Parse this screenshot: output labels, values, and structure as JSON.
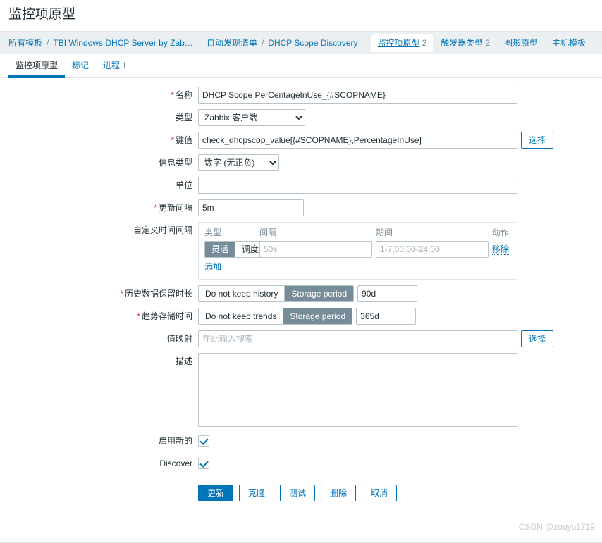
{
  "page": {
    "title": "监控项原型",
    "watermark": "CSDN @zouyu1719"
  },
  "breadcrumb": {
    "items": [
      {
        "label": "所有模板",
        "type": "link"
      },
      {
        "label": "TBI Windows DHCP Server by Zab…",
        "type": "link"
      },
      {
        "label": "自动发现清单",
        "type": "link"
      },
      {
        "label": "DHCP Scope Discovery",
        "type": "link"
      }
    ],
    "separator": "/",
    "tabs": [
      {
        "label": "监控项原型",
        "count": "2",
        "active": true
      },
      {
        "label": "触发器类型",
        "count": "2",
        "active": false
      },
      {
        "label": "图形原型",
        "count": "",
        "active": false
      },
      {
        "label": "主机模板",
        "count": "",
        "active": false
      }
    ]
  },
  "subtabs": [
    {
      "label": "监控项原型",
      "count": "",
      "active": true
    },
    {
      "label": "标记",
      "count": "",
      "active": false
    },
    {
      "label": "进程",
      "count": "1",
      "active": false
    }
  ],
  "form": {
    "name": {
      "label": "名称",
      "required": true,
      "value": "DHCP Scope PerCentageInUse_{#SCOPNAME}"
    },
    "type": {
      "label": "类型",
      "required": false,
      "value": "Zabbix 客户端",
      "options": [
        "Zabbix 客户端"
      ]
    },
    "key": {
      "label": "键值",
      "required": true,
      "value": "check_dhcpscop_value[{#SCOPNAME},PercentageInUse]",
      "select_button": "选择"
    },
    "info_type": {
      "label": "信息类型",
      "required": false,
      "value": "数字 (无正负)",
      "options": [
        "数字 (无正负)"
      ]
    },
    "units": {
      "label": "单位",
      "required": false,
      "value": ""
    },
    "update_interval": {
      "label": "更新间隔",
      "required": true,
      "value": "5m"
    },
    "custom_intervals": {
      "label": "自定义时间间隔",
      "required": false,
      "headers": {
        "type": "类型",
        "interval": "间隔",
        "period": "期间",
        "action": "动作"
      },
      "rows": [
        {
          "type_options": [
            "灵活",
            "调度"
          ],
          "type_selected": "灵活",
          "interval_value": "",
          "interval_placeholder": "50s",
          "period_value": "",
          "period_placeholder": "1-7,00:00-24:00",
          "remove_label": "移除"
        }
      ],
      "add_label": "添加"
    },
    "history": {
      "label": "历史数据保留时长",
      "required": true,
      "options": [
        "Do not keep history",
        "Storage period"
      ],
      "selected": "Storage period",
      "value": "90d"
    },
    "trends": {
      "label": "趋势存储时间",
      "required": true,
      "options": [
        "Do not keep trends",
        "Storage period"
      ],
      "selected": "Storage period",
      "value": "365d"
    },
    "value_map": {
      "label": "值映射",
      "required": false,
      "value": "",
      "placeholder": "在此输入搜索",
      "select_button": "选择"
    },
    "description": {
      "label": "描述",
      "required": false,
      "value": ""
    },
    "enabled": {
      "label": "启用新的",
      "checked": true
    },
    "discover": {
      "label": "Discover",
      "checked": true
    }
  },
  "actions": [
    {
      "label": "更新",
      "style": "primary"
    },
    {
      "label": "克隆",
      "style": "secondary"
    },
    {
      "label": "测试",
      "style": "secondary"
    },
    {
      "label": "删除",
      "style": "secondary"
    },
    {
      "label": "取消",
      "style": "secondary"
    }
  ],
  "colors": {
    "accent": "#0275b8",
    "segment_selected_bg": "#768d99",
    "required_star": "#d42f2f",
    "breadcrumb_bg": "#ebeff2",
    "border": "#dfe4e7",
    "input_border": "#b8c3c9",
    "muted_text": "#768d99"
  }
}
